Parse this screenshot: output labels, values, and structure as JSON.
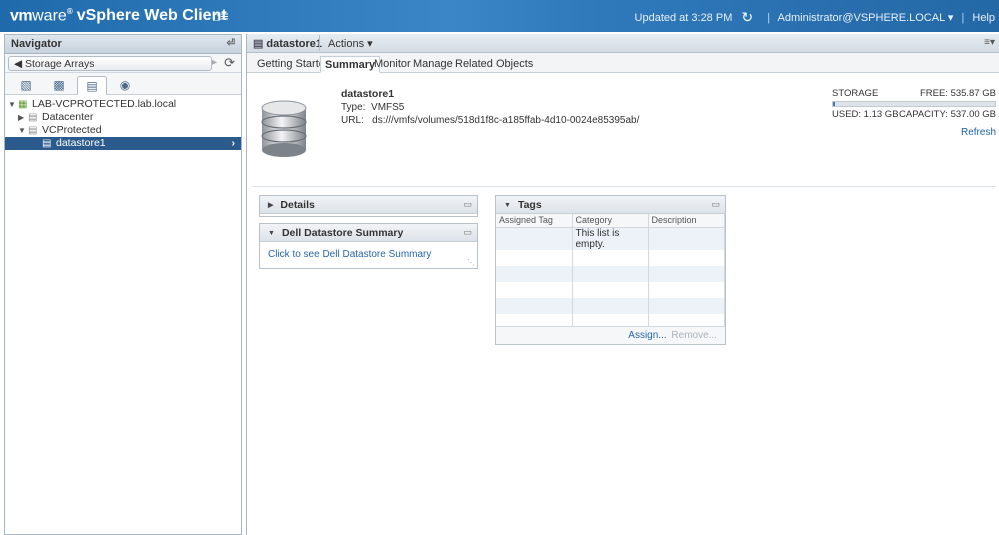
{
  "header": {
    "brand_vm": "vm",
    "brand_ware": "ware",
    "brand_reg": "®",
    "product": "vSphere Web Client",
    "updated": "Updated at 3:28 PM",
    "separator": "|",
    "user": "Administrator@VSPHERE.LOCAL",
    "help": "Help"
  },
  "navigator": {
    "title": "Navigator",
    "back_label": "Storage Arrays",
    "tree": [
      {
        "label": "LAB-VCPROTECTED.lab.local"
      },
      {
        "label": "Datacenter"
      },
      {
        "label": "VCProtected"
      },
      {
        "label": "datastore1"
      }
    ]
  },
  "object": {
    "title": "datastore1",
    "actions": "Actions"
  },
  "tabs": [
    "Getting Started",
    "Summary",
    "Monitor",
    "Manage",
    "Related Objects"
  ],
  "summary": {
    "name": "datastore1",
    "type_label": "Type:",
    "type_value": "VMFS5",
    "url_label": "URL:",
    "url_value": "ds:///vmfs/volumes/518d1f8c-a185ffab-4d10-0024e85395ab/"
  },
  "storage": {
    "label": "STORAGE",
    "free": "FREE: 535.87 GB",
    "used": "USED: 1.13 GB",
    "capacity": "CAPACITY: 537.00 GB",
    "used_fraction": 0.0021,
    "refresh": "Refresh"
  },
  "portlets": {
    "details": "Details",
    "dell_title": "Dell Datastore Summary",
    "dell_link": "Click to see Dell Datastore Summary",
    "tags_title": "Tags",
    "tags_columns": [
      "Assigned Tag",
      "Category",
      "Description"
    ],
    "tags_empty": "This list is empty.",
    "assign": "Assign...",
    "remove": "Remove..."
  },
  "colors": {
    "header": "#2f79bb",
    "selection": "#2b5b8c",
    "link": "#2767a9"
  }
}
